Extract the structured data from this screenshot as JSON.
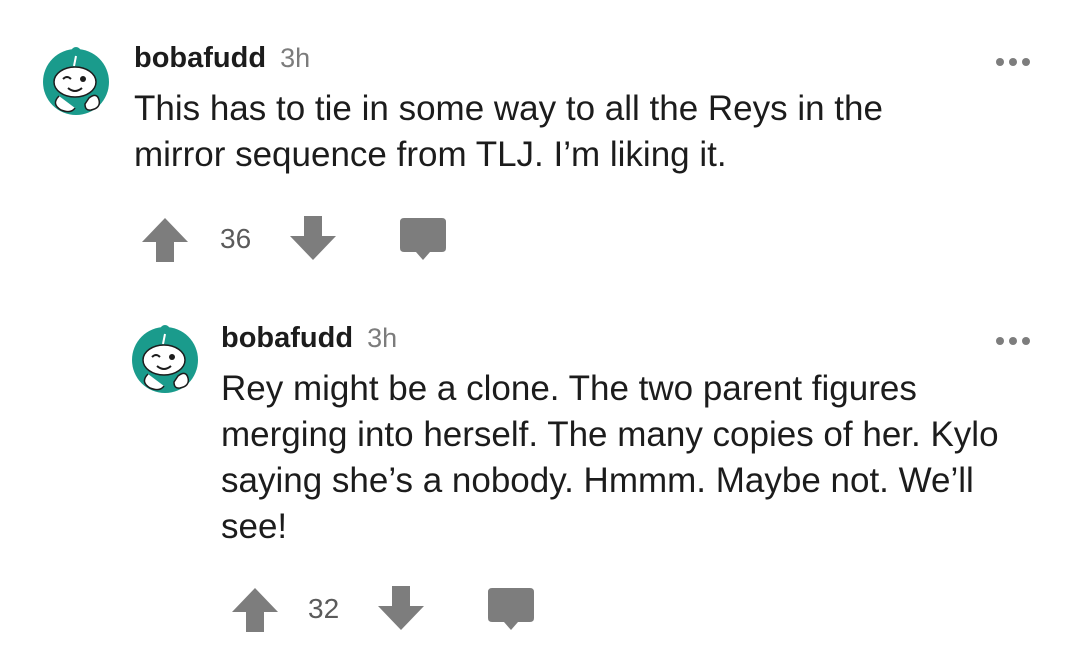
{
  "comments": [
    {
      "username": "bobafudd",
      "timestamp": "3h",
      "body": "This has to tie in some way to all the Reys in the mirror sequence from TLJ. I’m liking it.",
      "score": "36",
      "icons": {
        "more": "more-options-icon",
        "upvote": "upvote-arrow-icon",
        "downvote": "downvote-arrow-icon",
        "reply": "reply-bubble-icon"
      }
    },
    {
      "username": "bobafudd",
      "timestamp": "3h",
      "body": "Rey might be a clone. The two parent figures merging into herself. The many copies of her. Kylo saying she’s a nobody. Hmmm. Maybe not. We’ll see!",
      "score": "32",
      "icons": {
        "more": "more-options-icon",
        "upvote": "upvote-arrow-icon",
        "downvote": "downvote-arrow-icon",
        "reply": "reply-bubble-icon"
      }
    }
  ],
  "colors": {
    "avatar_bg": "#1a9b8c",
    "icon_gray": "#7d7d7d",
    "text": "#1c1c1c",
    "meta": "#7c7c7c"
  }
}
